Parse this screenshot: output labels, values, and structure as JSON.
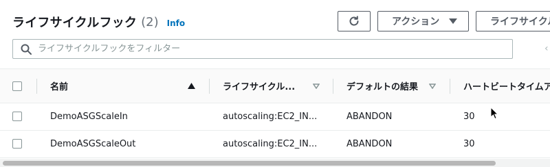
{
  "header": {
    "title": "ライフサイクルフック",
    "count": "(2)",
    "info_link": "Info"
  },
  "toolbar": {
    "refresh_icon": "refresh-icon",
    "actions_label": "アクション",
    "create_label": "ライフサイクルフックを作成"
  },
  "filter": {
    "placeholder": "ライフサイクルフックをフィルター",
    "value": ""
  },
  "table": {
    "columns": [
      {
        "label": "名前",
        "sort": "ascending"
      },
      {
        "label": "ライフサイクル...",
        "sort": "sortable"
      },
      {
        "label": "デフォルトの結果",
        "sort": "sortable"
      },
      {
        "label": "ハートビートタイムアウト",
        "sort": "sortable"
      }
    ],
    "rows": [
      {
        "name": "DemoASGScaleIn",
        "transition": "autoscaling:EC2_IN...",
        "default_result": "ABANDON",
        "heartbeat": "30"
      },
      {
        "name": "DemoASGScaleOut",
        "transition": "autoscaling:EC2_IN...",
        "default_result": "ABANDON",
        "heartbeat": "30"
      }
    ]
  },
  "colors": {
    "link": "#0073bb",
    "border": "#eaeded",
    "text": "#16191f",
    "muted": "#687078"
  }
}
